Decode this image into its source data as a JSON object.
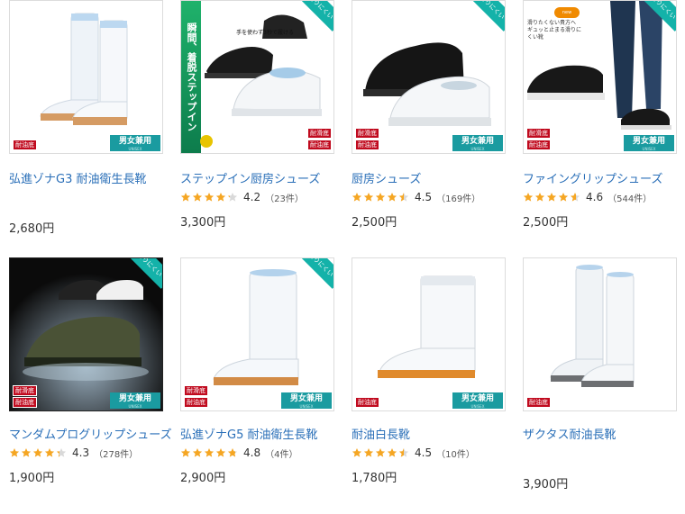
{
  "products": [
    {
      "title": "弘進ゾナG3 耐油衛生長靴",
      "price": "2,680円",
      "rating": null,
      "count": null,
      "badges": [
        "耐油底"
      ],
      "unisex": true,
      "ribbon": false
    },
    {
      "title": "ステップイン厨房シューズ",
      "price": "3,300円",
      "rating": "4.2",
      "count": "（23件）",
      "badges": [
        "耐滑底",
        "耐油底"
      ],
      "unisex": false,
      "ribbon": true,
      "banner": "瞬間、着脱ステップイン",
      "note": "手を使わず3秒で履ける"
    },
    {
      "title": "厨房シューズ",
      "price": "2,500円",
      "rating": "4.5",
      "count": "（169件）",
      "badges": [
        "耐滑底",
        "耐油底"
      ],
      "unisex": true,
      "ribbon": true
    },
    {
      "title": "ファイングリップシューズ",
      "price": "2,500円",
      "rating": "4.6",
      "count": "（544件）",
      "badges": [
        "耐滑底",
        "耐油底"
      ],
      "unisex": true,
      "ribbon": true,
      "tag": "new",
      "callout": "滑りたくない貴方へ　ギュッと止まる滑りにくい靴"
    },
    {
      "title": "マンダムプログリップシューズ",
      "price": "1,900円",
      "rating": "4.3",
      "count": "（278件）",
      "badges": [
        "耐滑底",
        "耐油底"
      ],
      "unisex": true,
      "ribbon": true
    },
    {
      "title": "弘進ゾナG5 耐油衛生長靴",
      "price": "2,900円",
      "rating": "4.8",
      "count": "（4件）",
      "badges": [
        "耐滑底",
        "耐油底"
      ],
      "unisex": true,
      "ribbon": true
    },
    {
      "title": "耐油白長靴",
      "price": "1,780円",
      "rating": "4.5",
      "count": "（10件）",
      "badges": [
        "耐油底"
      ],
      "unisex": true,
      "ribbon": false
    },
    {
      "title": "ザクタス耐油長靴",
      "price": "3,900円",
      "rating": null,
      "count": null,
      "badges": [
        "耐油底"
      ],
      "unisex": false,
      "ribbon": false
    }
  ],
  "labels": {
    "unisex": "男女兼用",
    "unisex_sub": "UNISEX",
    "ribbon": "滑りにくい"
  },
  "colors": {
    "link": "#2a6fb8",
    "star": "#f5a623",
    "badge": "#c00a1e",
    "unisex": "#1a9ba0",
    "ribbon": "#14b2a9"
  }
}
